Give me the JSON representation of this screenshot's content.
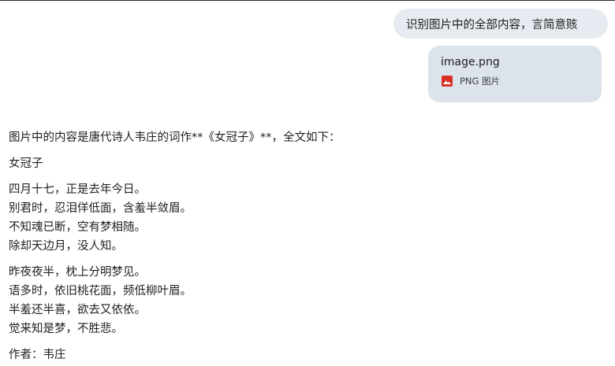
{
  "user_message": {
    "text": "识别图片中的全部内容，言简意赅"
  },
  "attachment": {
    "file_name": "image.png",
    "file_type": "PNG 图片",
    "icon": "image-icon",
    "icon_color": "#d93025"
  },
  "response": {
    "intro": "图片中的内容是唐代诗人韦庄的词作**《女冠子》**，全文如下：",
    "title": "女冠子",
    "stanzas": [
      {
        "lines": [
          "四月十七，正是去年今日。",
          "别君时，忍泪佯低面，含羞半敛眉。",
          "不知魂已断，空有梦相随。",
          "除却天边月，没人知。"
        ]
      },
      {
        "lines": [
          "昨夜夜半，枕上分明梦见。",
          "语多时，依旧桃花面，频低柳叶眉。",
          "半羞还半喜，欲去又依依。",
          "觉来知是梦，不胜悲。"
        ]
      }
    ],
    "author": "作者：韦庄"
  }
}
